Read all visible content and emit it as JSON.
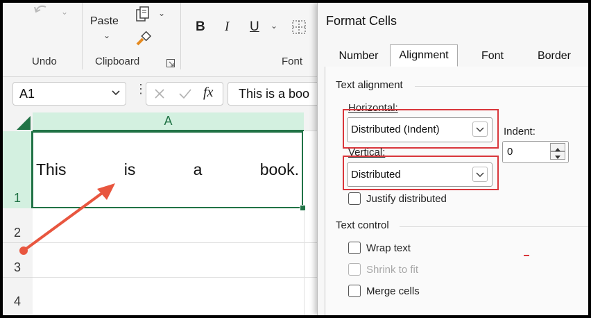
{
  "ribbon": {
    "paste_label": "Paste",
    "undo_label": "Undo",
    "clipboard_label": "Clipboard",
    "font_label": "Font",
    "bold": "B",
    "italic": "I",
    "underline": "U"
  },
  "formula_bar": {
    "name_box": "A1",
    "fx": "fx",
    "content": "This is a boo"
  },
  "sheet": {
    "column_a": "A",
    "rows": [
      "1",
      "2",
      "3",
      "4"
    ],
    "cell_a1_words": [
      "This",
      "is",
      "a",
      "book."
    ]
  },
  "dialog": {
    "title": "Format Cells",
    "tabs": [
      "Number",
      "Alignment",
      "Font",
      "Border"
    ],
    "active_tab": "Alignment",
    "text_alignment_title": "Text alignment",
    "horizontal_label": "Horizontal:",
    "horizontal_value": "Distributed (Indent)",
    "indent_label": "Indent:",
    "indent_value": "0",
    "vertical_label": "Vertical:",
    "vertical_value": "Distributed",
    "justify_distributed": "Justify distributed",
    "text_control_title": "Text control",
    "wrap_text": "Wrap text",
    "shrink_to_fit": "Shrink to fit",
    "merge_cells": "Merge cells"
  },
  "colors": {
    "highlight": "#d9363b",
    "arrow": "#e8563f",
    "excel_green": "#217346"
  }
}
